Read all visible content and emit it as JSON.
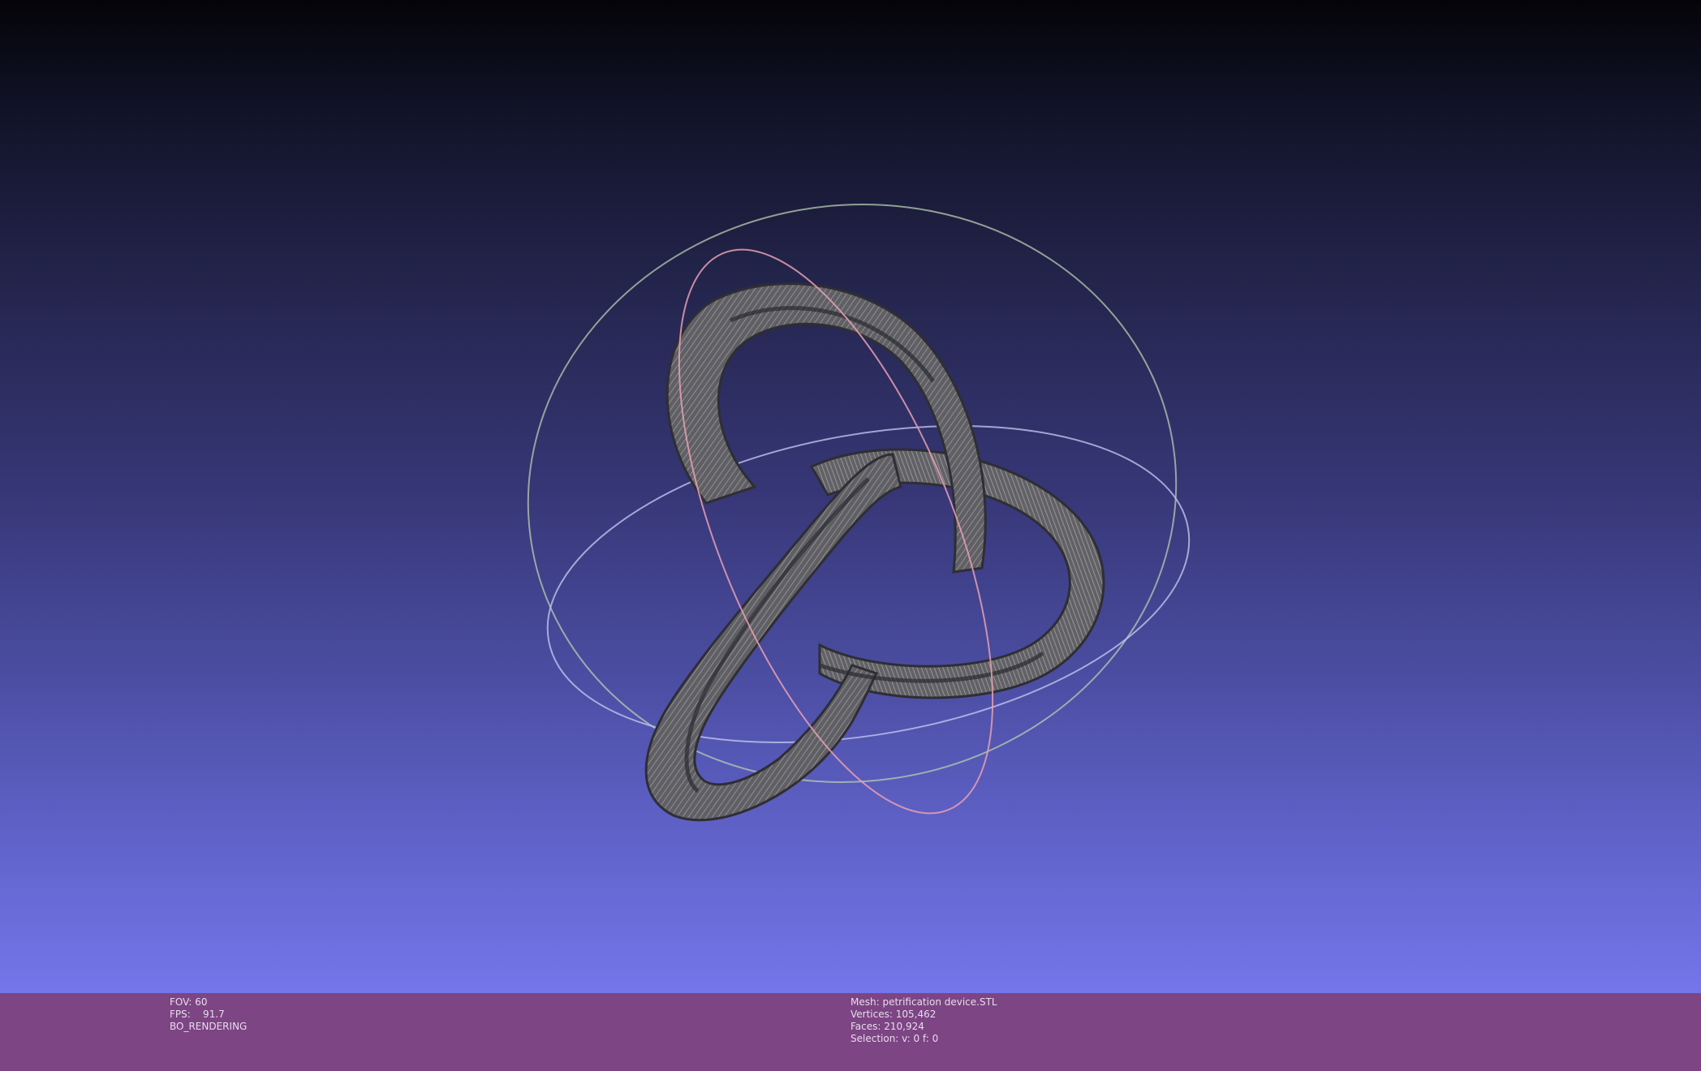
{
  "viewer": {
    "background_top": "#040408",
    "background_bottom": "#7476ea",
    "mesh_color": "#5a5a5e",
    "trackball_colors": {
      "x_axis": "#e8a0b0",
      "y_axis": "#b8ccb0",
      "z_axis": "#c0c4ec"
    }
  },
  "status_bar": {
    "color": "#7d4584",
    "left": {
      "fov": "FOV: 60",
      "fps": "FPS:    91.7",
      "render_mode": "BO_RENDERING"
    },
    "right": {
      "mesh": "Mesh: petrification device.STL",
      "vertices": "Vertices: 105,462",
      "faces": "Faces: 210,924",
      "selection": "Selection: v: 0 f: 0"
    }
  }
}
